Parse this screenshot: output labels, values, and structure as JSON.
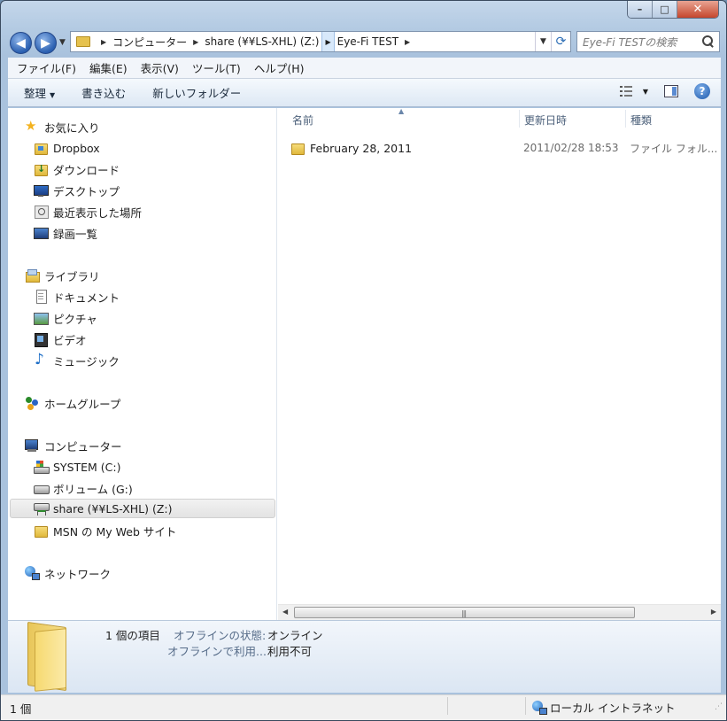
{
  "caption": {
    "minimize": "–",
    "maximize": "□",
    "close": "✕"
  },
  "address": {
    "crumbs": [
      "コンピューター",
      "share (¥¥LS-XHL) (Z:)",
      "Eye-Fi TEST"
    ]
  },
  "search": {
    "placeholder": "Eye-Fi TESTの検索"
  },
  "menu": [
    "ファイル(F)",
    "編集(E)",
    "表示(V)",
    "ツール(T)",
    "ヘルプ(H)"
  ],
  "commands": {
    "organize": "整理",
    "burn": "書き込む",
    "new_folder": "新しいフォルダー"
  },
  "nav": {
    "favorites": "お気に入り",
    "dropbox": "Dropbox",
    "downloads": "ダウンロード",
    "desktop": "デスクトップ",
    "recent": "最近表示した場所",
    "recorded_tv": "録画一覧",
    "libraries": "ライブラリ",
    "documents": "ドキュメント",
    "pictures": "ピクチャ",
    "videos": "ビデオ",
    "music": "ミュージック",
    "homegroup": "ホームグループ",
    "computer": "コンピューター",
    "system_c": "SYSTEM (C:)",
    "volume_g": "ボリューム (G:)",
    "share_z": "share (¥¥LS-XHL) (Z:)",
    "msn": "MSN の My Web サイト",
    "network": "ネットワーク"
  },
  "columns": {
    "name": "名前",
    "date": "更新日時",
    "type": "種類"
  },
  "files": [
    {
      "name": "February 28, 2011",
      "date": "2011/02/28 18:53",
      "type": "ファイル フォル..."
    }
  ],
  "details": {
    "count": "1 個の項目",
    "offline_status_label": "オフラインの状態:",
    "offline_status_value": "オンライン",
    "offline_use_label": "オフラインで利用...",
    "offline_use_value": "利用不可"
  },
  "status": {
    "count": "1 個",
    "zone": "ローカル イントラネット"
  }
}
